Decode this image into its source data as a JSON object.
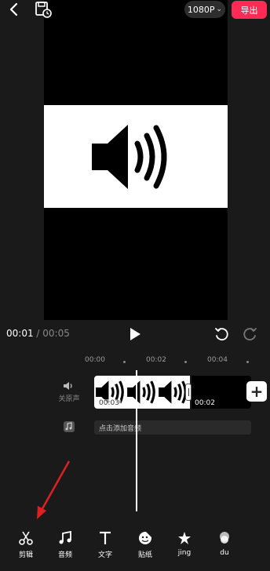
{
  "header": {
    "resolution": "1080P",
    "export_label": "导出"
  },
  "player": {
    "current_time": "00:01",
    "separator": " / ",
    "total_time": "00:05"
  },
  "ruler": {
    "ticks": [
      "00:00",
      "00:02",
      "00:04"
    ]
  },
  "tracks": {
    "audio_label": "关原声",
    "clip1_time": "00:03",
    "clip2_time": "00:02",
    "add_music_label": "点击添加音频"
  },
  "toolbar": {
    "items": [
      {
        "label": "剪辑",
        "icon": "scissors-icon"
      },
      {
        "label": "音频",
        "icon": "music-note-icon"
      },
      {
        "label": "文字",
        "icon": "text-icon"
      },
      {
        "label": "贴纸",
        "icon": "sticker-icon"
      },
      {
        "label": "jing",
        "icon": "effects-icon"
      },
      {
        "label": "du",
        "icon": "filter-icon"
      }
    ]
  },
  "colors": {
    "accent": "#fe2c55",
    "background": "#1a1a1a",
    "annotation_arrow": "#e02020"
  }
}
